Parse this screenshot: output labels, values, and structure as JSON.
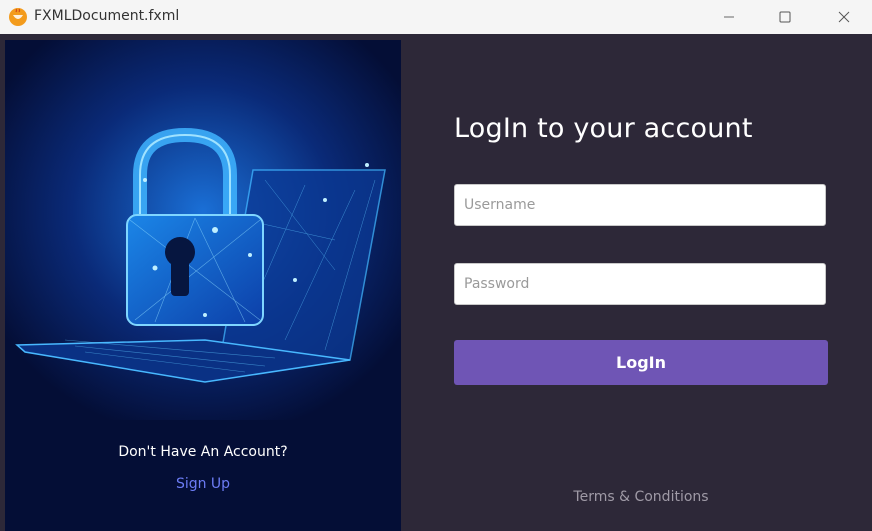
{
  "window": {
    "title": "FXMLDocument.fxml",
    "app_icon": "java-cup-icon",
    "controls": [
      "minimize-icon",
      "maximize-icon",
      "close-icon"
    ]
  },
  "left_panel": {
    "illustration": "padlock-laptop-icon",
    "account_question": "Don't Have An Account?",
    "signup_label": "Sign Up",
    "signup_color": "#6c7cf5"
  },
  "login_form": {
    "heading": "LogIn to your account",
    "username_placeholder": "Username",
    "password_placeholder": "Password",
    "login_label": "LogIn",
    "button_color": "#6f55b5",
    "terms_label": "Terms & Conditions"
  }
}
